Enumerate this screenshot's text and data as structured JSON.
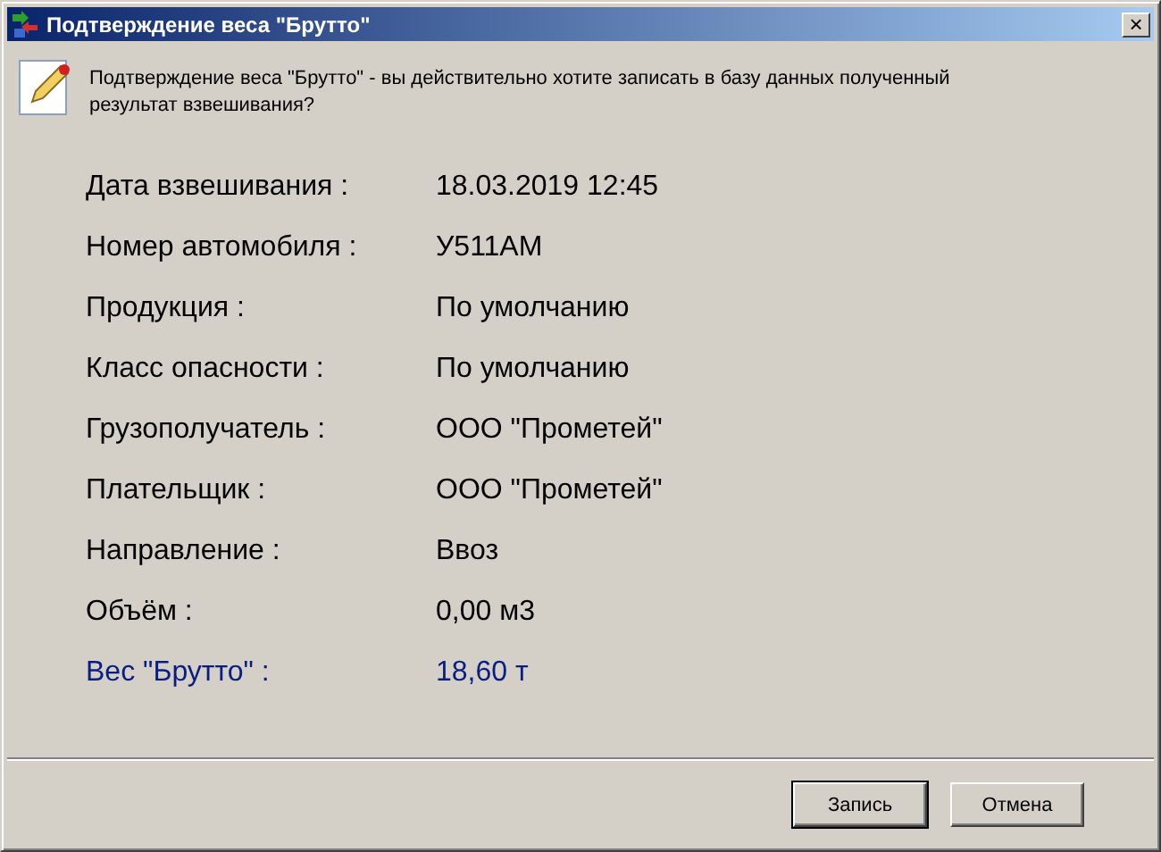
{
  "window": {
    "title": "Подтверждение веса \"Брутто\"",
    "close": "×"
  },
  "message": "Подтверждение веса \"Брутто\" - вы действительно хотите записать в базу данных полученный результат взвешивания?",
  "fields": [
    {
      "label": "Дата взвешивания :",
      "value": "18.03.2019 12:45",
      "kind": "normal"
    },
    {
      "label": "Номер автомобиля :",
      "value": "У511АМ",
      "kind": "normal"
    },
    {
      "label": "Продукция :",
      "value": "По умолчанию",
      "kind": "normal"
    },
    {
      "label": "Класс опасности :",
      "value": "По умолчанию",
      "kind": "normal"
    },
    {
      "label": "Грузополучатель :",
      "value": "ООО \"Прометей\"",
      "kind": "normal"
    },
    {
      "label": "Плательщик :",
      "value": "ООО \"Прометей\"",
      "kind": "normal"
    },
    {
      "label": "Направление :",
      "value": "Ввоз",
      "kind": "normal"
    },
    {
      "label": "Объём :",
      "value": "0,00 м3",
      "kind": "normal"
    },
    {
      "label": "Вес \"Брутто\" :",
      "value": "18,60 т",
      "kind": "highlight"
    }
  ],
  "buttons": [
    {
      "label": "Запись",
      "default": true
    },
    {
      "label": "Отмена",
      "default": false
    }
  ]
}
